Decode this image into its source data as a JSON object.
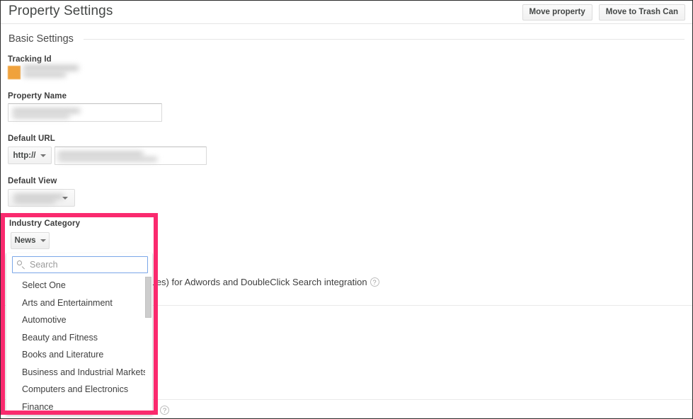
{
  "header": {
    "title": "Property Settings",
    "buttons": [
      {
        "label": "Move property",
        "name": "move-property-button"
      },
      {
        "label": "Move to Trash Can",
        "name": "move-to-trash-can-button"
      }
    ]
  },
  "section": {
    "title": "Basic Settings"
  },
  "fields": {
    "tracking_id": {
      "label": "Tracking Id",
      "value": "",
      "swatch_color": "#f0a23c",
      "redacted": true
    },
    "property_name": {
      "label": "Property Name",
      "value": "",
      "redacted": true
    },
    "default_url": {
      "label": "Default URL",
      "protocol": "http://",
      "value": "",
      "redacted": true
    },
    "default_view": {
      "label": "Default View",
      "value": "",
      "redacted": true
    },
    "industry_category": {
      "label": "Industry Category",
      "selected": "News"
    }
  },
  "dropdown": {
    "search_placeholder": "Search",
    "search_value": "",
    "items": [
      "Select One",
      "Arts and Entertainment",
      "Automotive",
      "Beauty and Fitness",
      "Books and Literature",
      "Business and Industrial Markets",
      "Computers and Electronics",
      "Finance"
    ]
  },
  "background_row": {
    "text": "o override auto-tagging (GCLID values) for Adwords and DoubleClick Search integration",
    "help_glyph": "?"
  },
  "bottom_row": {
    "help_glyph": "?"
  },
  "colors": {
    "highlight": "#fa2a6e",
    "accent_orange": "#f0a23c",
    "focus_blue": "#7ba7e8"
  }
}
